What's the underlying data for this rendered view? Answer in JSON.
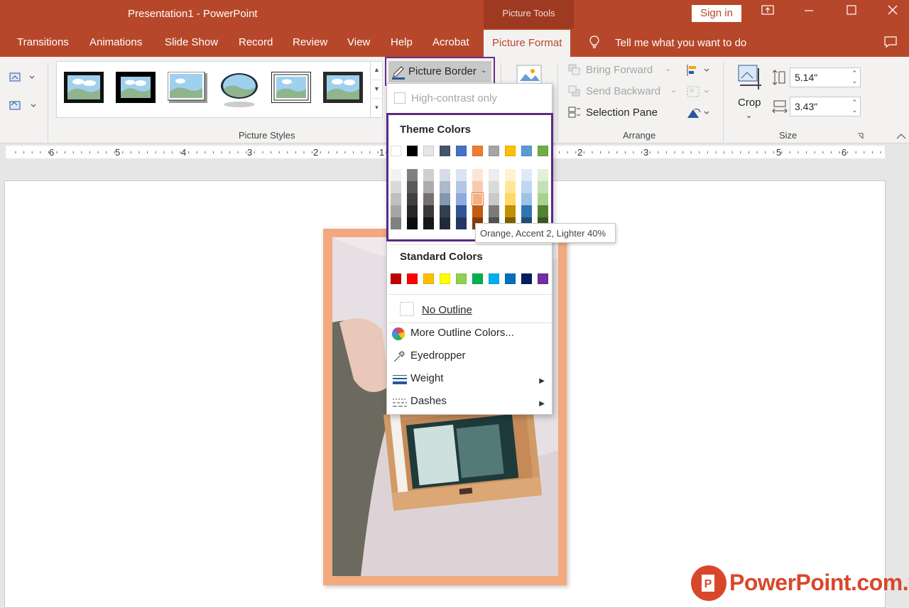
{
  "window": {
    "title": "Presentation1  -  PowerPoint",
    "context_group": "Picture Tools",
    "sign_in": "Sign in"
  },
  "tabs": [
    "Transitions",
    "Animations",
    "Slide Show",
    "Record",
    "Review",
    "View",
    "Help",
    "Acrobat",
    "Picture Format"
  ],
  "active_tab": "Picture Format",
  "tell_me": "Tell me what you want to do",
  "ribbon": {
    "picture_border": "Picture Border",
    "picture_styles_label": "Picture Styles",
    "arrange_label": "Arrange",
    "size_label": "Size",
    "bring_forward": "Bring Forward",
    "send_backward": "Send Backward",
    "selection_pane": "Selection Pane",
    "crop": "Crop",
    "height": "5.14\"",
    "width": "3.43\""
  },
  "ruler": {
    "labels": [
      "6",
      "5",
      "4",
      "3",
      "2",
      "1",
      "2",
      "3",
      "5",
      "6"
    ]
  },
  "dropdown": {
    "high_contrast": "High-contrast only",
    "theme_colors_head": "Theme Colors",
    "theme_colors": [
      "#ffffff",
      "#000000",
      "#e7e6e6",
      "#44546a",
      "#4472c4",
      "#ed7d31",
      "#a5a5a5",
      "#ffc000",
      "#5b9bd5",
      "#70ad47"
    ],
    "theme_shades": [
      [
        "#f2f2f2",
        "#d9d9d9",
        "#bfbfbf",
        "#a6a6a6",
        "#808080"
      ],
      [
        "#7f7f7f",
        "#595959",
        "#404040",
        "#262626",
        "#0d0d0d"
      ],
      [
        "#d0cece",
        "#aeabab",
        "#757171",
        "#3a3838",
        "#171616"
      ],
      [
        "#d6dce5",
        "#adb9ca",
        "#8497b0",
        "#333f50",
        "#222a35"
      ],
      [
        "#dae3f3",
        "#b4c7e7",
        "#8faadc",
        "#2f5597",
        "#1f3864"
      ],
      [
        "#fbe5d6",
        "#f8cbad",
        "#f4b183",
        "#c55a11",
        "#843c0c"
      ],
      [
        "#ededed",
        "#dbdbdb",
        "#c9c9c9",
        "#7b7b7b",
        "#525252"
      ],
      [
        "#fff2cc",
        "#ffe699",
        "#ffd966",
        "#bf9000",
        "#7f6000"
      ],
      [
        "#deebf7",
        "#bdd7ee",
        "#9dc3e6",
        "#2e75b6",
        "#1f4e79"
      ],
      [
        "#e2f0d9",
        "#c5e0b4",
        "#a9d18e",
        "#548235",
        "#385723"
      ]
    ],
    "standard_colors_head": "Standard Colors",
    "standard_colors": [
      "#c00000",
      "#ff0000",
      "#ffc000",
      "#ffff00",
      "#92d050",
      "#00b050",
      "#00b0f0",
      "#0070c0",
      "#002060",
      "#7030a0"
    ],
    "no_outline": "No Outline",
    "more_colors": "More Outline Colors...",
    "eyedropper": "Eyedropper",
    "weight": "Weight",
    "dashes": "Dashes"
  },
  "tooltip": "Orange, Accent 2, Lighter 40%",
  "watermark": "PowerPoint.com.vn",
  "colors": {
    "brand": "#b7472a",
    "highlight": "#5b2a86",
    "picture_border": "#f2a97e"
  }
}
